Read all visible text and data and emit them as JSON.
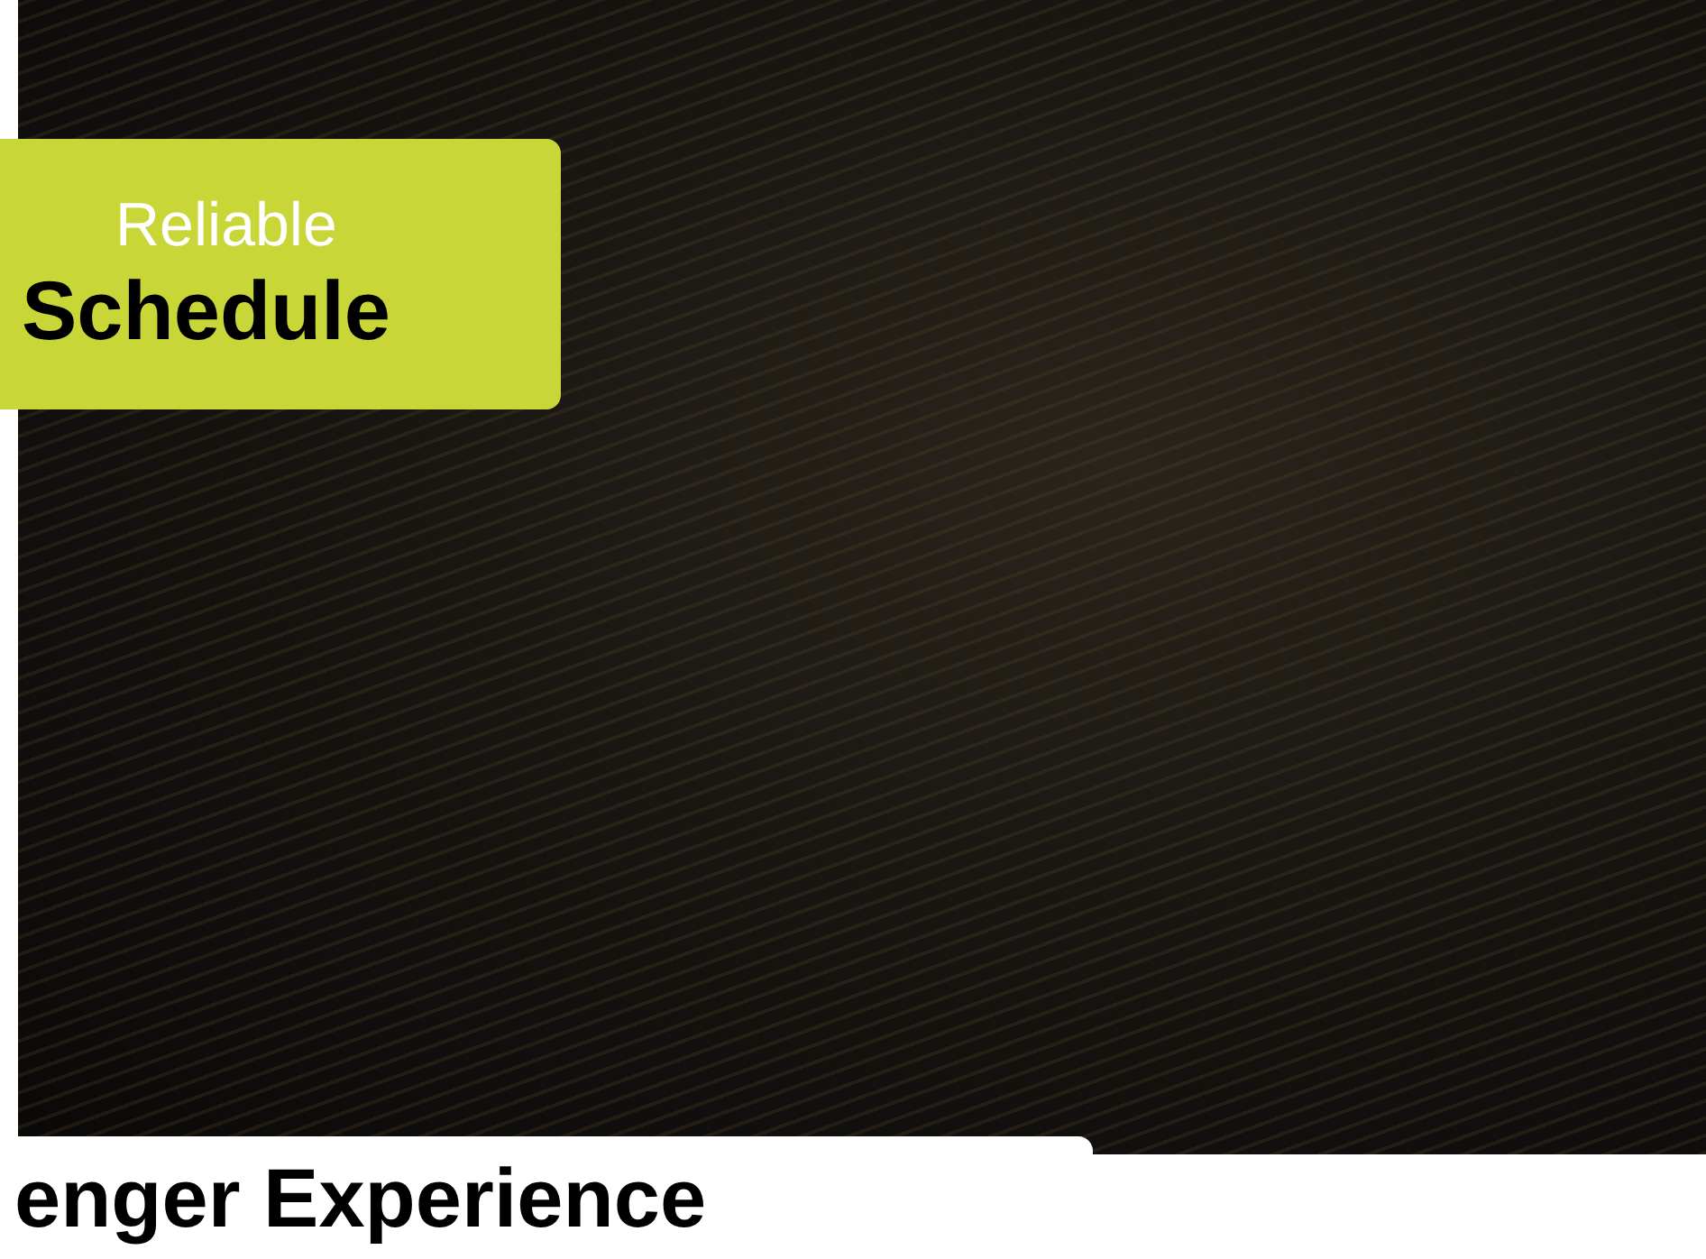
{
  "hero": {
    "badge": {
      "line_1": "Reliable",
      "line_2": "Schedule"
    },
    "caption": "enger Experience"
  }
}
